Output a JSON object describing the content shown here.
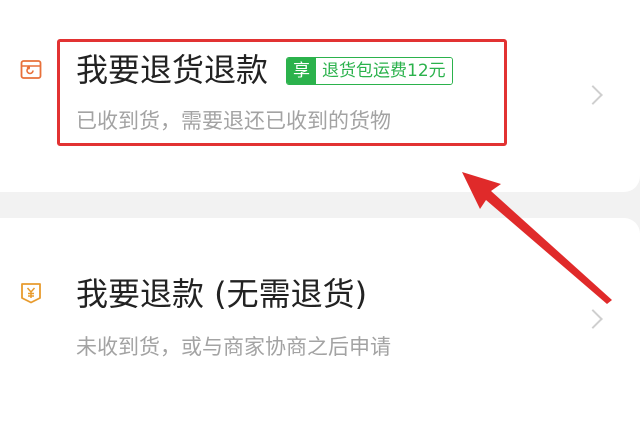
{
  "options": [
    {
      "title": "我要退货退款",
      "badge": {
        "prefix": "享",
        "text": "退货包运费12元"
      },
      "subtitle": "已收到货，需要退还已收到的货物",
      "icon": "return-box-icon"
    },
    {
      "title": "我要退款 (无需退货)",
      "subtitle": "未收到货，或与商家协商之后申请",
      "icon": "yuan-refund-icon"
    }
  ],
  "colors": {
    "badge_green": "#2bb24c",
    "icon_orange": "#e8703a",
    "annotation_red": "#e23232",
    "title_text": "#222222",
    "subtitle_text": "#a3a3a3"
  }
}
